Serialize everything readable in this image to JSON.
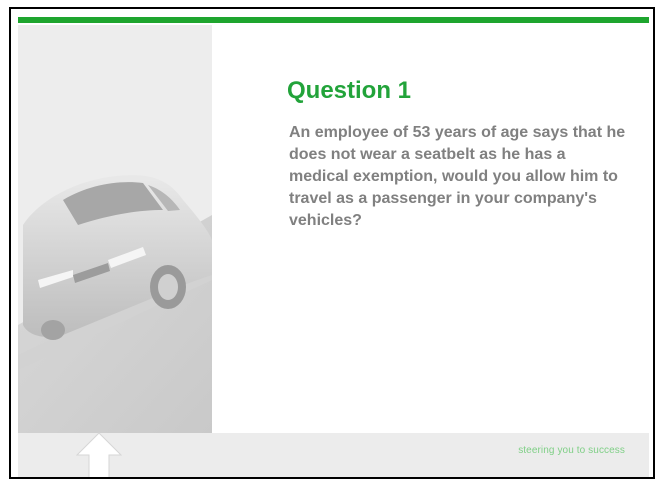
{
  "slide": {
    "title": "Question 1",
    "question": "An employee of 53 years of age says that he does not wear a seatbelt as he has a medical exemption, would you allow him to travel as a passenger in your company's vehicles?",
    "tagline": "steering you to success"
  },
  "images": {
    "left_panel": "car-image",
    "footer_icon": "up-arrow-icon"
  },
  "colors": {
    "accent_green": "#1ea52e",
    "title_green": "#22a33a",
    "body_text_gray": "#808080",
    "tagline_green": "#7fcf86",
    "panel_gray": "#ececec"
  }
}
